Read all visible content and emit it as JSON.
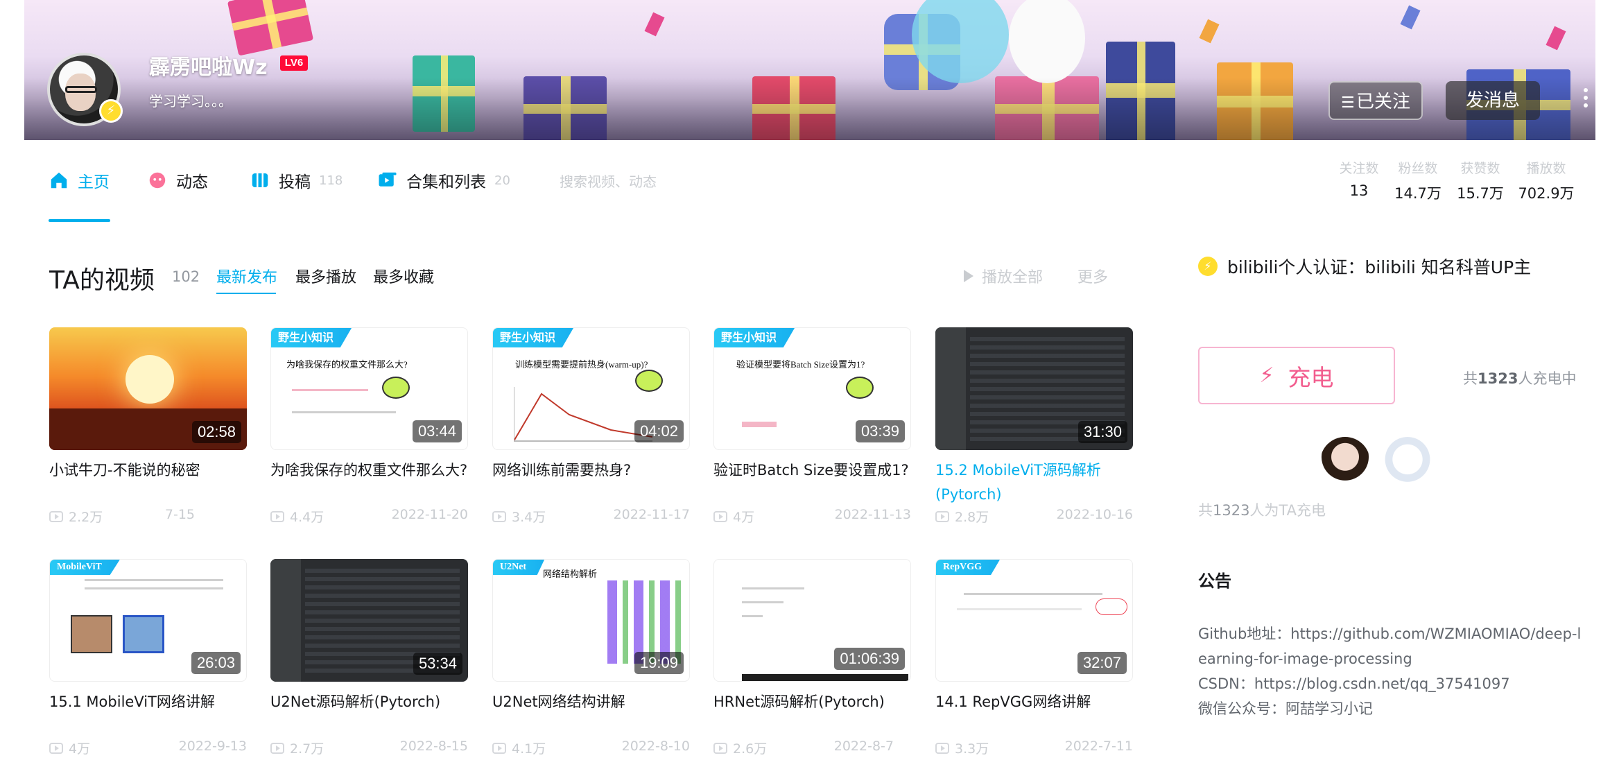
{
  "profile": {
    "username": "霹雳吧啦Wz",
    "level": "LV6",
    "signature": "学习学习。。。",
    "follow_button": "已关注",
    "message_button": "发消息"
  },
  "nav": {
    "items": [
      {
        "label": "主页",
        "count": ""
      },
      {
        "label": "动态",
        "count": ""
      },
      {
        "label": "投稿",
        "count": "118"
      },
      {
        "label": "合集和列表",
        "count": "20"
      }
    ],
    "search_placeholder": "搜索视频、动态"
  },
  "stats": [
    {
      "label": "关注数",
      "value": "13"
    },
    {
      "label": "粉丝数",
      "value": "14.7万"
    },
    {
      "label": "获赞数",
      "value": "15.7万"
    },
    {
      "label": "播放数",
      "value": "702.9万"
    }
  ],
  "videos_section": {
    "title": "TA的视频",
    "count": "102",
    "sorts": [
      "最新发布",
      "最多播放",
      "最多收藏"
    ],
    "play_all": "播放全部",
    "more": "更多"
  },
  "videos": [
    {
      "title": "小试牛刀-不能说的秘密",
      "duration": "02:58",
      "views": "2.2万",
      "date": "7-15",
      "ribbon": ""
    },
    {
      "title": "为啥我保存的权重文件那么大?",
      "duration": "03:44",
      "views": "4.4万",
      "date": "2022-11-20",
      "ribbon": "野生小知识",
      "thumb_caption": "为啥我保存的权重文件那么大?"
    },
    {
      "title": "网络训练前需要热身?",
      "duration": "04:02",
      "views": "3.4万",
      "date": "2022-11-17",
      "ribbon": "野生小知识",
      "thumb_caption": "训练模型需要提前热身(warm-up)?"
    },
    {
      "title": "验证时Batch Size要设置成1?",
      "duration": "03:39",
      "views": "4万",
      "date": "2022-11-13",
      "ribbon": "野生小知识",
      "thumb_caption": "验证模型要将Batch Size设置为1?"
    },
    {
      "title": "15.2 MobileViT源码解析(Pytorch)",
      "duration": "31:30",
      "views": "2.8万",
      "date": "2022-10-16",
      "ribbon": ""
    },
    {
      "title": "15.1 MobileViT网络讲解",
      "duration": "26:03",
      "views": "4万",
      "date": "2022-9-13",
      "ribbon": "MobileViT"
    },
    {
      "title": "U2Net源码解析(Pytorch)",
      "duration": "53:34",
      "views": "2.7万",
      "date": "2022-8-15",
      "ribbon": ""
    },
    {
      "title": "U2Net网络结构讲解",
      "duration": "19:09",
      "views": "4.1万",
      "date": "2022-8-10",
      "ribbon": "U2Net",
      "thumb_caption": "网络结构解析"
    },
    {
      "title": "HRNet源码解析(Pytorch)",
      "duration": "01:06:39",
      "views": "2.6万",
      "date": "2022-8-7",
      "ribbon": ""
    },
    {
      "title": "14.1 RepVGG网络讲解",
      "duration": "32:07",
      "views": "3.3万",
      "date": "2022-7-11",
      "ribbon": "RepVGG"
    }
  ],
  "sidebar": {
    "certification": "bilibili个人认证：bilibili 知名科普UP主",
    "charge_button": "充电",
    "charge_count_prefix": "共",
    "charge_count_num": "1323",
    "charge_count_suffix": "人充电中",
    "charge_summary_prefix": "共",
    "charge_summary_num": "1323",
    "charge_summary_suffix": "人为TA充电",
    "notice_title": "公告",
    "notice_lines": [
      "Github地址：https://github.com/WZMIAOMIAO/deep-learning-for-image-processing",
      "CSDN：https://blog.csdn.net/qq_37541097",
      "微信公众号：阿喆学习小记"
    ]
  },
  "colors": {
    "accent": "#00aeec",
    "charge_pink": "#f25d8e",
    "level_red": "#ff0b37",
    "cert_yellow": "#ffdd2e"
  }
}
